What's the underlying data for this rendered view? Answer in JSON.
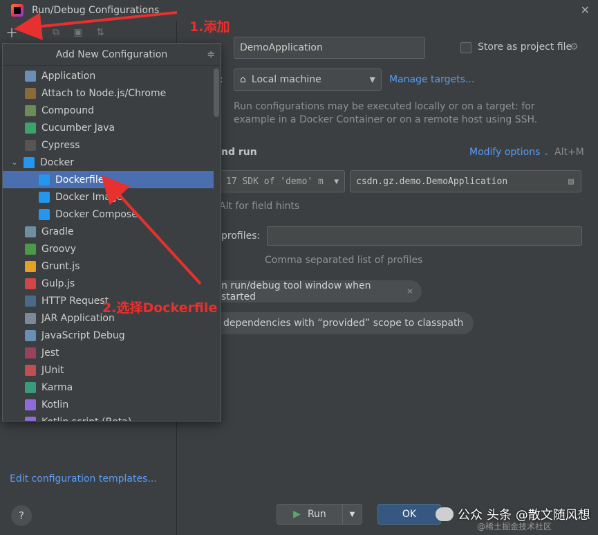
{
  "window": {
    "title": "Run/Debug Configurations"
  },
  "popup": {
    "header": "Add New Configuration",
    "items": [
      {
        "label": "Application",
        "icon": "application-icon",
        "color": "#6a8fb5",
        "indent": 0
      },
      {
        "label": "Attach to Node.js/Chrome",
        "icon": "nodejs-attach-icon",
        "color": "#8a6a3a",
        "indent": 0
      },
      {
        "label": "Compound",
        "icon": "compound-icon",
        "color": "#6c8a5a",
        "indent": 0
      },
      {
        "label": "Cucumber Java",
        "icon": "cucumber-icon",
        "color": "#3aa46a",
        "indent": 0
      },
      {
        "label": "Cypress",
        "icon": "cypress-icon",
        "color": "#555555",
        "indent": 0
      },
      {
        "label": "Docker",
        "icon": "docker-icon",
        "color": "#2496ed",
        "indent": 0,
        "expanded": true
      },
      {
        "label": "Dockerfile",
        "icon": "docker-icon",
        "color": "#2496ed",
        "indent": 1,
        "selected": true
      },
      {
        "label": "Docker Image",
        "icon": "docker-icon",
        "color": "#2496ed",
        "indent": 1
      },
      {
        "label": "Docker Compose",
        "icon": "docker-icon",
        "color": "#2496ed",
        "indent": 1
      },
      {
        "label": "Gradle",
        "icon": "gradle-icon",
        "color": "#6f8fa0",
        "indent": 0
      },
      {
        "label": "Groovy",
        "icon": "groovy-icon",
        "color": "#4a9a4a",
        "indent": 0
      },
      {
        "label": "Grunt.js",
        "icon": "grunt-icon",
        "color": "#e4a125",
        "indent": 0
      },
      {
        "label": "Gulp.js",
        "icon": "gulp-icon",
        "color": "#cf4647",
        "indent": 0
      },
      {
        "label": "HTTP Request",
        "icon": "http-request-icon",
        "color": "#4a6a8a",
        "indent": 0
      },
      {
        "label": "JAR Application",
        "icon": "jar-icon",
        "color": "#7a8a9a",
        "indent": 0
      },
      {
        "label": "JavaScript Debug",
        "icon": "javascript-debug-icon",
        "color": "#6a8fb5",
        "indent": 0
      },
      {
        "label": "Jest",
        "icon": "jest-icon",
        "color": "#99425b",
        "indent": 0
      },
      {
        "label": "JUnit",
        "icon": "junit-icon",
        "color": "#c05050",
        "indent": 0
      },
      {
        "label": "Karma",
        "icon": "karma-icon",
        "color": "#3a9a7a",
        "indent": 0
      },
      {
        "label": "Kotlin",
        "icon": "kotlin-icon",
        "color": "#8f6bd8",
        "indent": 0
      },
      {
        "label": "Kotlin script (Beta)",
        "icon": "kotlin-script-icon",
        "color": "#8f6bd8",
        "indent": 0
      }
    ]
  },
  "form": {
    "name_value": "DemoApplication",
    "store_as_project_file": "Store as project file",
    "run_on_label": ":",
    "run_on_value": "Local machine",
    "manage_targets": "Manage targets...",
    "run_hint_1": "Run configurations may be executed locally or on a target: for",
    "run_hint_2": "example in a Docker Container or on a remote host using SSH.",
    "section_build_run": "nd run",
    "modify_options": "Modify options",
    "modify_shortcut": "Alt+M",
    "sdk_value": "17 SDK of 'demo' m",
    "main_class_value": "csdn.gz.demo.DemoApplication",
    "field_hints": "Alt for field hints",
    "profiles_label": "profiles:",
    "profiles_value": "",
    "profiles_hint": "Comma separated list of profiles",
    "chip_1": "n run/debug tool window when started",
    "chip_2": "dependencies with “provided” scope to classpath"
  },
  "footer": {
    "edit_templates": "Edit configuration templates...",
    "help": "?",
    "run": "Run",
    "ok": "OK"
  },
  "annotations": {
    "step1": "1.添加",
    "step2": "2.选择Dockerfile"
  },
  "watermark": {
    "left": "公众",
    "main": "头条 @散文随风想",
    "sub": "@稀土掘金技术社区"
  },
  "colors": {
    "accent_link": "#589df6",
    "selection": "#4b6eaf",
    "annotation_red": "#e8302e",
    "ok_button": "#365880"
  }
}
